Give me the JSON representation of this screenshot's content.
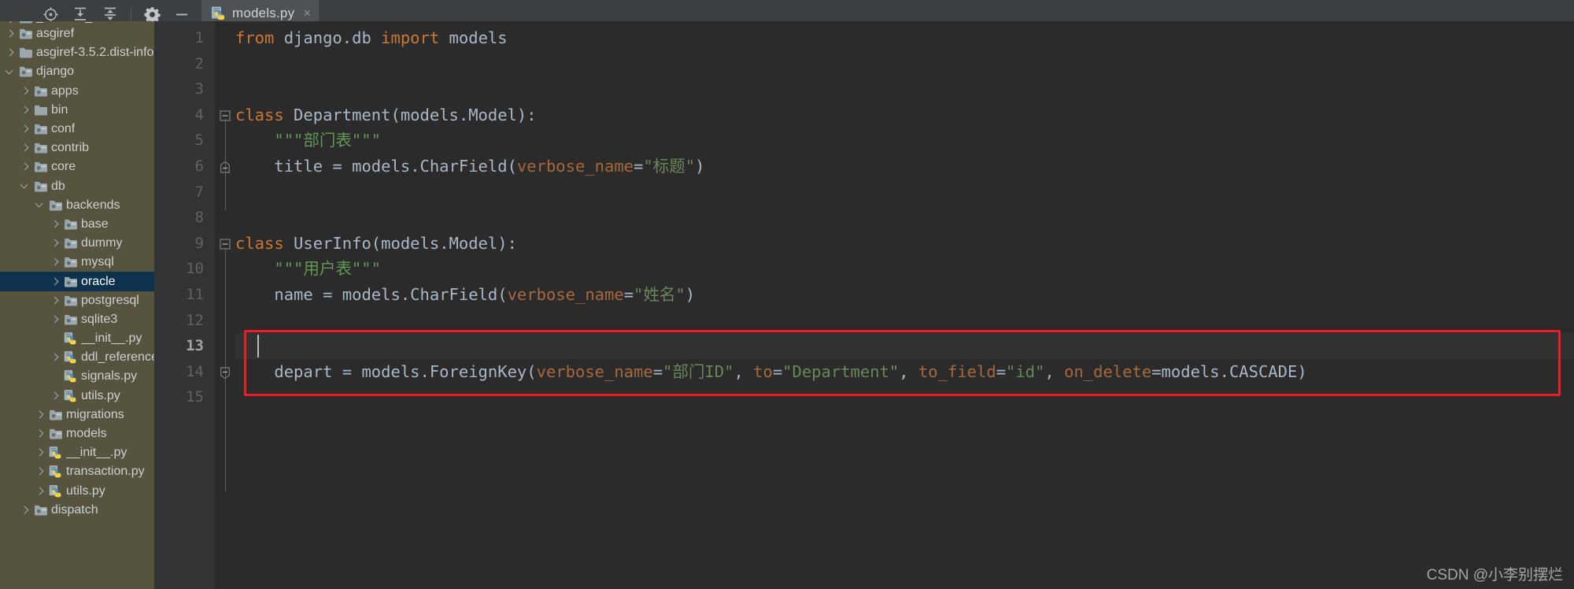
{
  "toolbar": {
    "buttons": [
      {
        "name": "locate-icon",
        "label": "Select Opened File"
      },
      {
        "name": "collapse-all-icon",
        "label": "Collapse All"
      },
      {
        "name": "expand-all-icon",
        "label": "Expand All"
      },
      {
        "name": "gear-icon",
        "label": "Settings"
      },
      {
        "name": "minimize-icon",
        "label": "Hide"
      }
    ]
  },
  "tab": {
    "icon": "python-file-icon",
    "label": "models.py",
    "close": "×"
  },
  "sidebar": {
    "items": [
      {
        "label": "_distutils_hack",
        "type": "folder-src",
        "arrow": "right",
        "indent": 0,
        "selected": false,
        "clipped": true
      },
      {
        "label": "asgiref",
        "type": "folder-src",
        "arrow": "right",
        "indent": 0,
        "selected": false
      },
      {
        "label": "asgiref-3.5.2.dist-info",
        "type": "folder",
        "arrow": "right",
        "indent": 0,
        "selected": false
      },
      {
        "label": "django",
        "type": "folder-src",
        "arrow": "down",
        "indent": 0,
        "selected": false
      },
      {
        "label": "apps",
        "type": "folder-src",
        "arrow": "right",
        "indent": 1,
        "selected": false
      },
      {
        "label": "bin",
        "type": "folder",
        "arrow": "right",
        "indent": 1,
        "selected": false
      },
      {
        "label": "conf",
        "type": "folder-src",
        "arrow": "right",
        "indent": 1,
        "selected": false
      },
      {
        "label": "contrib",
        "type": "folder-src",
        "arrow": "right",
        "indent": 1,
        "selected": false
      },
      {
        "label": "core",
        "type": "folder-src",
        "arrow": "right",
        "indent": 1,
        "selected": false
      },
      {
        "label": "db",
        "type": "folder-src",
        "arrow": "down",
        "indent": 1,
        "selected": false
      },
      {
        "label": "backends",
        "type": "folder-src",
        "arrow": "down",
        "indent": 2,
        "selected": false
      },
      {
        "label": "base",
        "type": "folder-src",
        "arrow": "right",
        "indent": 3,
        "selected": false
      },
      {
        "label": "dummy",
        "type": "folder-src",
        "arrow": "right",
        "indent": 3,
        "selected": false
      },
      {
        "label": "mysql",
        "type": "folder-src",
        "arrow": "right",
        "indent": 3,
        "selected": false
      },
      {
        "label": "oracle",
        "type": "folder-src",
        "arrow": "right",
        "indent": 3,
        "selected": true
      },
      {
        "label": "postgresql",
        "type": "folder-src",
        "arrow": "right",
        "indent": 3,
        "selected": false
      },
      {
        "label": "sqlite3",
        "type": "folder-src",
        "arrow": "right",
        "indent": 3,
        "selected": false
      },
      {
        "label": "__init__.py",
        "type": "python",
        "arrow": "none",
        "indent": 3,
        "selected": false
      },
      {
        "label": "ddl_references.py",
        "type": "python",
        "arrow": "right",
        "indent": 3,
        "selected": false
      },
      {
        "label": "signals.py",
        "type": "python",
        "arrow": "none",
        "indent": 3,
        "selected": false
      },
      {
        "label": "utils.py",
        "type": "python",
        "arrow": "right",
        "indent": 3,
        "selected": false
      },
      {
        "label": "migrations",
        "type": "folder-src",
        "arrow": "right",
        "indent": 2,
        "selected": false
      },
      {
        "label": "models",
        "type": "folder-src",
        "arrow": "right",
        "indent": 2,
        "selected": false
      },
      {
        "label": "__init__.py",
        "type": "python",
        "arrow": "right",
        "indent": 2,
        "selected": false
      },
      {
        "label": "transaction.py",
        "type": "python",
        "arrow": "right",
        "indent": 2,
        "selected": false
      },
      {
        "label": "utils.py",
        "type": "python",
        "arrow": "right",
        "indent": 2,
        "selected": false
      },
      {
        "label": "dispatch",
        "type": "folder-src",
        "arrow": "right",
        "indent": 1,
        "selected": false
      }
    ]
  },
  "editor": {
    "line_numbers": [
      "1",
      "2",
      "3",
      "4",
      "5",
      "6",
      "7",
      "8",
      "9",
      "10",
      "11",
      "12",
      "13",
      "14",
      "15"
    ],
    "current_line": 13,
    "lines": [
      {
        "n": 1,
        "text": "from django.db import models"
      },
      {
        "n": 2,
        "text": ""
      },
      {
        "n": 3,
        "text": ""
      },
      {
        "n": 4,
        "text": "class Department(models.Model):"
      },
      {
        "n": 5,
        "text": "    \"\"\"部门表\"\"\""
      },
      {
        "n": 6,
        "text": "    title = models.CharField(verbose_name=\"标题\")"
      },
      {
        "n": 7,
        "text": ""
      },
      {
        "n": 8,
        "text": ""
      },
      {
        "n": 9,
        "text": "class UserInfo(models.Model):"
      },
      {
        "n": 10,
        "text": "    \"\"\"用户表\"\"\""
      },
      {
        "n": 11,
        "text": "    name = models.CharField(verbose_name=\"姓名\")"
      },
      {
        "n": 12,
        "text": ""
      },
      {
        "n": 13,
        "text": ""
      },
      {
        "n": 14,
        "text": "    depart = models.ForeignKey(verbose_name=\"部门ID\", to=\"Department\", to_field=\"id\", on_delete=models.CASCADE)"
      },
      {
        "n": 15,
        "text": ""
      }
    ],
    "tokens": {
      "l1": [
        {
          "t": "from",
          "c": "k"
        },
        {
          "t": " django.db ",
          "c": "w"
        },
        {
          "t": "import",
          "c": "k"
        },
        {
          "t": " models",
          "c": "w"
        }
      ],
      "l4": [
        {
          "t": "class",
          "c": "k"
        },
        {
          "t": " Department(models.Model):",
          "c": "w"
        }
      ],
      "l5": [
        {
          "t": "    \"\"\"部门表\"\"\"",
          "c": "doc"
        }
      ],
      "l6": [
        {
          "t": "    title = models.CharField(",
          "c": "w"
        },
        {
          "t": "verbose_name",
          "c": "kw"
        },
        {
          "t": "=",
          "c": "w"
        },
        {
          "t": "\"标题\"",
          "c": "s"
        },
        {
          "t": ")",
          "c": "w"
        }
      ],
      "l9": [
        {
          "t": "class",
          "c": "k"
        },
        {
          "t": " UserInfo(models.Model):",
          "c": "w"
        }
      ],
      "l10": [
        {
          "t": "    \"\"\"用户表\"\"\"",
          "c": "doc"
        }
      ],
      "l11": [
        {
          "t": "    name = models.CharField(",
          "c": "w"
        },
        {
          "t": "verbose_name",
          "c": "kw"
        },
        {
          "t": "=",
          "c": "w"
        },
        {
          "t": "\"姓名\"",
          "c": "s"
        },
        {
          "t": ")",
          "c": "w"
        }
      ],
      "l14": [
        {
          "t": "    depart = models.ForeignKey(",
          "c": "w"
        },
        {
          "t": "verbose_name",
          "c": "kw"
        },
        {
          "t": "=",
          "c": "w"
        },
        {
          "t": "\"部门ID\"",
          "c": "s"
        },
        {
          "t": ", ",
          "c": "w"
        },
        {
          "t": "to",
          "c": "kw"
        },
        {
          "t": "=",
          "c": "w"
        },
        {
          "t": "\"Department\"",
          "c": "s"
        },
        {
          "t": ", ",
          "c": "w"
        },
        {
          "t": "to_field",
          "c": "kw"
        },
        {
          "t": "=",
          "c": "w"
        },
        {
          "t": "\"id\"",
          "c": "s"
        },
        {
          "t": ", ",
          "c": "w"
        },
        {
          "t": "on_delete",
          "c": "kw"
        },
        {
          "t": "=models.CASCADE)",
          "c": "w"
        }
      ]
    }
  },
  "annotation": {
    "name": "red-highlight-box",
    "color": "#ee1c25",
    "covers_lines": "13-14"
  },
  "watermark": {
    "text": "CSDN @小李别摆烂"
  },
  "colors": {
    "editor_bg": "#2b2b2b",
    "gutter_bg": "#313335",
    "sidebar_bg": "#56543f",
    "toolbar_bg": "#3c3f41",
    "selection_bg": "#0d324d",
    "tab_underline": "#4a88c7",
    "keyword": "#cc7832",
    "string": "#6a8759",
    "kwarg": "#a9683b",
    "text": "#a9b7c6",
    "annotation": "#ee1c25"
  }
}
